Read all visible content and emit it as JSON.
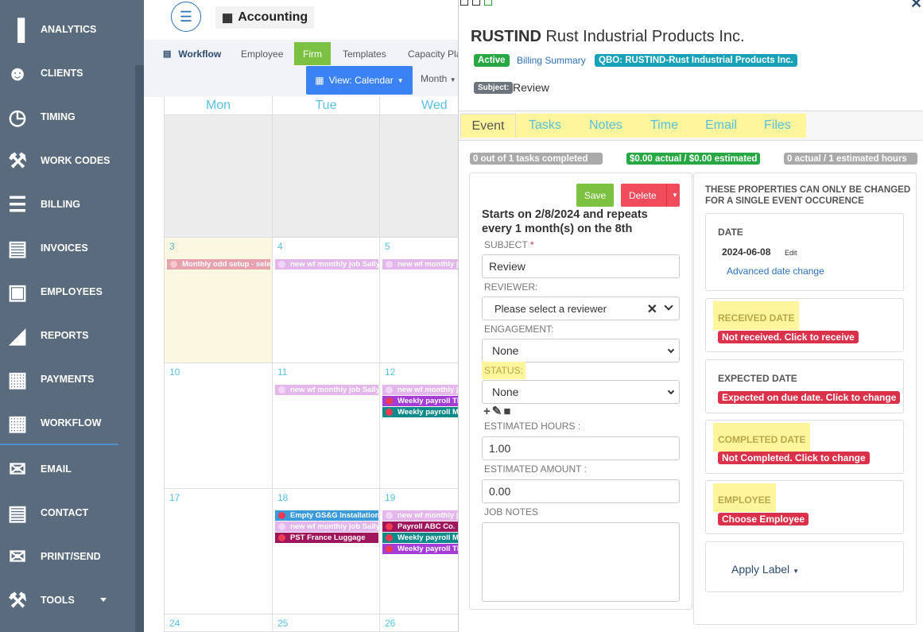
{
  "sidebar": {
    "items": [
      {
        "label": "ANALYTICS",
        "icon": "bar-chart-icon"
      },
      {
        "label": "CLIENTS",
        "icon": "users-icon"
      },
      {
        "label": "TIMING",
        "icon": "clock-icon"
      },
      {
        "label": "WORK CODES",
        "icon": "wrench-icon"
      },
      {
        "label": "BILLING",
        "icon": "list-icon"
      },
      {
        "label": "INVOICES",
        "icon": "document-icon"
      },
      {
        "label": "EMPLOYEES",
        "icon": "briefcase-icon"
      },
      {
        "label": "REPORTS",
        "icon": "area-chart-icon"
      },
      {
        "label": "PAYMENTS",
        "icon": "money-icon"
      },
      {
        "label": "WORKFLOW",
        "icon": "calendar-icon"
      },
      {
        "label": "EMAIL",
        "icon": "envelope-icon"
      },
      {
        "label": "CONTACT",
        "icon": "contact-card-icon"
      },
      {
        "label": "PRINT/SEND",
        "icon": "print-send-icon"
      },
      {
        "label": "TOOLS",
        "icon": "tools-icon"
      }
    ]
  },
  "header": {
    "menu_icon": "hamburger-icon",
    "title": "Accounting"
  },
  "workflow_tabs": [
    "Workflow",
    "Employee",
    "Firm",
    "Templates",
    "Capacity Pla"
  ],
  "view_button": "View: Calendar",
  "month_button": "Month",
  "calendar": {
    "days": [
      "Mon",
      "Tue",
      "Wed"
    ],
    "rows": [
      {
        "dates": [
          "",
          "",
          ""
        ]
      },
      {
        "dates": [
          "3",
          "4",
          "5"
        ]
      },
      {
        "dates": [
          "10",
          "11",
          "12"
        ]
      },
      {
        "dates": [
          "17",
          "18",
          "19"
        ]
      },
      {
        "dates": [
          "24",
          "25",
          "26"
        ]
      }
    ],
    "events": {
      "r1c0": "Monthly odd setup - selec",
      "r1c1": "new wf monthly job Sally",
      "r1c2": "new wf monthly jo",
      "r2c1": "new wf monthly job Sally",
      "r2c2a": "new wf monthly jo",
      "r2c2b": "Weekly payroll Th",
      "r2c2c": "Weekly payroll Mi",
      "r3c1a": "Empty GS&G Installations",
      "r3c1b": "new wf monthly job Sally",
      "r3c1c": "PST France Luggage",
      "r3c2a": "new wf monthly jo",
      "r3c2b": "Payroll ABC Co.",
      "r3c2c": "Weekly payroll Mi",
      "r3c2d": "Weekly payroll Th"
    }
  },
  "panel": {
    "code": "RUSTIND",
    "name": "Rust Industrial Products Inc.",
    "status_badge": "Active",
    "billing_summary": "Billing Summary",
    "qbo_badge": "QBO: RUSTIND-Rust Industrial Products Inc.",
    "subject_badge": "Subject:",
    "subject_value": "Review",
    "tabs": [
      "Event",
      "Tasks",
      "Notes",
      "Time",
      "Email",
      "Files"
    ],
    "progress": {
      "tasks": {
        "label": "0 out of 1 tasks completed",
        "fraction": 0
      },
      "money": {
        "label": "$0.00 actual / $0.00 estimated",
        "fraction": 1
      },
      "hours": {
        "label": "0 actual / 1 estimated hours",
        "fraction": 0
      }
    },
    "save": "Save",
    "delete": "Delete",
    "repeat_text": "Starts on 2/8/2024 and repeats every 1 month(s) on the 8th",
    "subject_label": "SUBJECT",
    "required_mark": "*",
    "subject_input": "Review",
    "reviewer_label": "REVIEWER:",
    "reviewer_placeholder": "Please select a reviewer",
    "engagement_label": "ENGAGEMENT:",
    "engagement_value": "None",
    "status_label": "STATUS:",
    "status_value": "None",
    "est_hours_label": "ESTIMATED HOURS :",
    "est_hours_value": "1.00",
    "est_amount_label": "ESTIMATED AMOUNT :",
    "est_amount_value": "0.00",
    "job_notes_label": "JOB NOTES",
    "props_heading": "THESE PROPERTIES CAN ONLY BE CHANGED FOR A SINGLE EVENT OCCURENCE",
    "date_label": "DATE",
    "date_value": "2024-06-08",
    "date_edit": "Edit",
    "advanced_date": "Advanced date change",
    "received_label": "RECEIVED DATE",
    "received_badge": "Not received. Click to receive",
    "expected_label": "EXPECTED DATE",
    "expected_badge": "Expected on due date. Click to change",
    "completed_label": "COMPLETED DATE",
    "completed_badge": "Not Completed. Click to change",
    "employee_label": "EMPLOYEE",
    "employee_badge": "Choose Employee",
    "apply_label": "Apply Label"
  },
  "colors": {
    "sidebar": "#5a6b7e",
    "accent": "#5bc0de",
    "green": "#7cc142",
    "red": "#d9324a",
    "teal": "#17a2b8",
    "highlight": "#fff59d"
  }
}
